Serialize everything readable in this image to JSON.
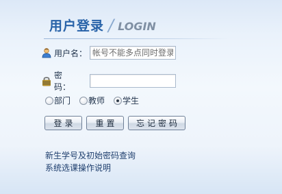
{
  "header": {
    "title_cn": "用户登录",
    "separator": "/",
    "title_en": "LOGIN"
  },
  "form": {
    "username_label": "用户名：",
    "username_placeholder": "帐号不能多点同时登录",
    "password_label_part1": "密",
    "password_label_part2": "码：",
    "password_value": ""
  },
  "roles": [
    {
      "label": "部门",
      "checked": false
    },
    {
      "label": "教师",
      "checked": false
    },
    {
      "label": "学生",
      "checked": true
    }
  ],
  "buttons": {
    "login": "登录",
    "reset": "重置",
    "forgot": "忘记密码"
  },
  "links": {
    "new_student": "新生学号及初始密码查询",
    "course_help": "系统选课操作说明"
  },
  "icons": {
    "user": "user-icon",
    "password": "lock-icon"
  }
}
